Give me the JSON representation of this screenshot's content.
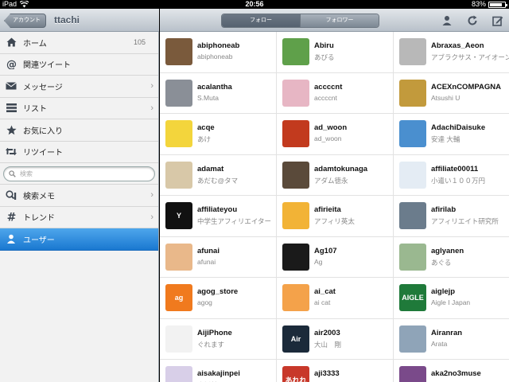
{
  "status_bar": {
    "device": "iPad",
    "time": "20:56",
    "battery_percent": 83,
    "battery_label": "83%"
  },
  "nav_header": {
    "back_label": "アカウント",
    "title": "ttachi"
  },
  "sidebar": {
    "items": [
      {
        "label": "ホーム",
        "icon": "home-icon",
        "count": "105",
        "chevron": false
      },
      {
        "label": "関連ツイート",
        "icon": "at-icon",
        "count": "",
        "chevron": false
      },
      {
        "label": "メッセージ",
        "icon": "envelope-icon",
        "count": "",
        "chevron": true
      },
      {
        "label": "リスト",
        "icon": "list-icon",
        "count": "",
        "chevron": true
      },
      {
        "label": "お気に入り",
        "icon": "star-icon",
        "count": "",
        "chevron": false
      },
      {
        "label": "リツイート",
        "icon": "retweet-icon",
        "count": "",
        "chevron": false
      }
    ],
    "search_placeholder": "検索",
    "items2": [
      {
        "label": "検索メモ",
        "icon": "search-memo-icon",
        "chevron": true
      },
      {
        "label": "トレンド",
        "icon": "hash-icon",
        "chevron": true
      },
      {
        "label": "ユーザー",
        "icon": "user-icon",
        "chevron": false,
        "selected": true
      }
    ]
  },
  "main_header": {
    "tabs": [
      {
        "label": "フォロー",
        "active": true
      },
      {
        "label": "フォロワー",
        "active": false
      }
    ],
    "icons": [
      "user-icon",
      "refresh-icon",
      "compose-icon"
    ]
  },
  "users": [
    {
      "username": "abiphoneab",
      "display": "abiphoneab",
      "avatar_color": "#7a5a3c"
    },
    {
      "username": "Abiru",
      "display": "あびる",
      "avatar_color": "#5fa04a"
    },
    {
      "username": "Abraxas_Aeon",
      "display": "アブラクサス・アイオーン",
      "avatar_color": "#b8b8b8"
    },
    {
      "username": "acalantha",
      "display": "S.Muta",
      "avatar_color": "#8a8f97"
    },
    {
      "username": "accccnt",
      "display": "accccnt",
      "avatar_color": "#e7b6c4"
    },
    {
      "username": "ACEXnCOMPAGNA",
      "display": "Atsushi U",
      "avatar_color": "#c29a3c"
    },
    {
      "username": "acqe",
      "display": "あけ",
      "avatar_color": "#f3d53c"
    },
    {
      "username": "ad_woon",
      "display": "ad_woon",
      "avatar_color": "#c23a1e"
    },
    {
      "username": "AdachiDaisuke",
      "display": "安達 大輔",
      "avatar_color": "#4a8fcf"
    },
    {
      "username": "adamat",
      "display": "あだむ@タマ",
      "avatar_color": "#d8c8a8"
    },
    {
      "username": "adamtokunaga",
      "display": "アダム徳永",
      "avatar_color": "#5a4a3a"
    },
    {
      "username": "affiliate00011",
      "display": "小遣い１００万円",
      "avatar_color": "#e4ecf4"
    },
    {
      "username": "affiliateyou",
      "display": "中学生アフィリエイター",
      "avatar_color": "#111111"
    },
    {
      "username": "afirieita",
      "display": "アフィリ英太",
      "avatar_color": "#f2b336"
    },
    {
      "username": "afirilab",
      "display": "アフィリエイト研究所",
      "avatar_color": "#6b7c8c"
    },
    {
      "username": "afunai",
      "display": "afunai",
      "avatar_color": "#e9b88a"
    },
    {
      "username": "Ag107",
      "display": "Ag",
      "avatar_color": "#1a1a1a"
    },
    {
      "username": "aglyanen",
      "display": "あぐる",
      "avatar_color": "#9ab890"
    },
    {
      "username": "agog_store",
      "display": "agog",
      "avatar_color": "#f07a1e"
    },
    {
      "username": "ai_cat",
      "display": "ai cat",
      "avatar_color": "#f4a24a"
    },
    {
      "username": "aiglejp",
      "display": "Aigle I Japan",
      "avatar_color": "#1f7a3a"
    },
    {
      "username": "AijiPhone",
      "display": "ぐれます",
      "avatar_color": "#f2f2f2"
    },
    {
      "username": "air2003",
      "display": "大山　剛",
      "avatar_color": "#1b2a3a"
    },
    {
      "username": "Airanran",
      "display": "Arata",
      "avatar_color": "#8fa4b8"
    },
    {
      "username": "aisakajinpei",
      "display": "逢坂甚平",
      "avatar_color": "#d8cfe8"
    },
    {
      "username": "aji3333",
      "display": "あじ",
      "avatar_color": "#c8382a"
    },
    {
      "username": "aka2no3muse",
      "display": "あかにのさん",
      "avatar_color": "#7a4a8a"
    }
  ],
  "avatar_text": {
    "agog_store": "ag",
    "air2003": "Air",
    "affiliateyou": "Y",
    "aiglejp": "AIGLE",
    "aji3333": "あれれ"
  }
}
